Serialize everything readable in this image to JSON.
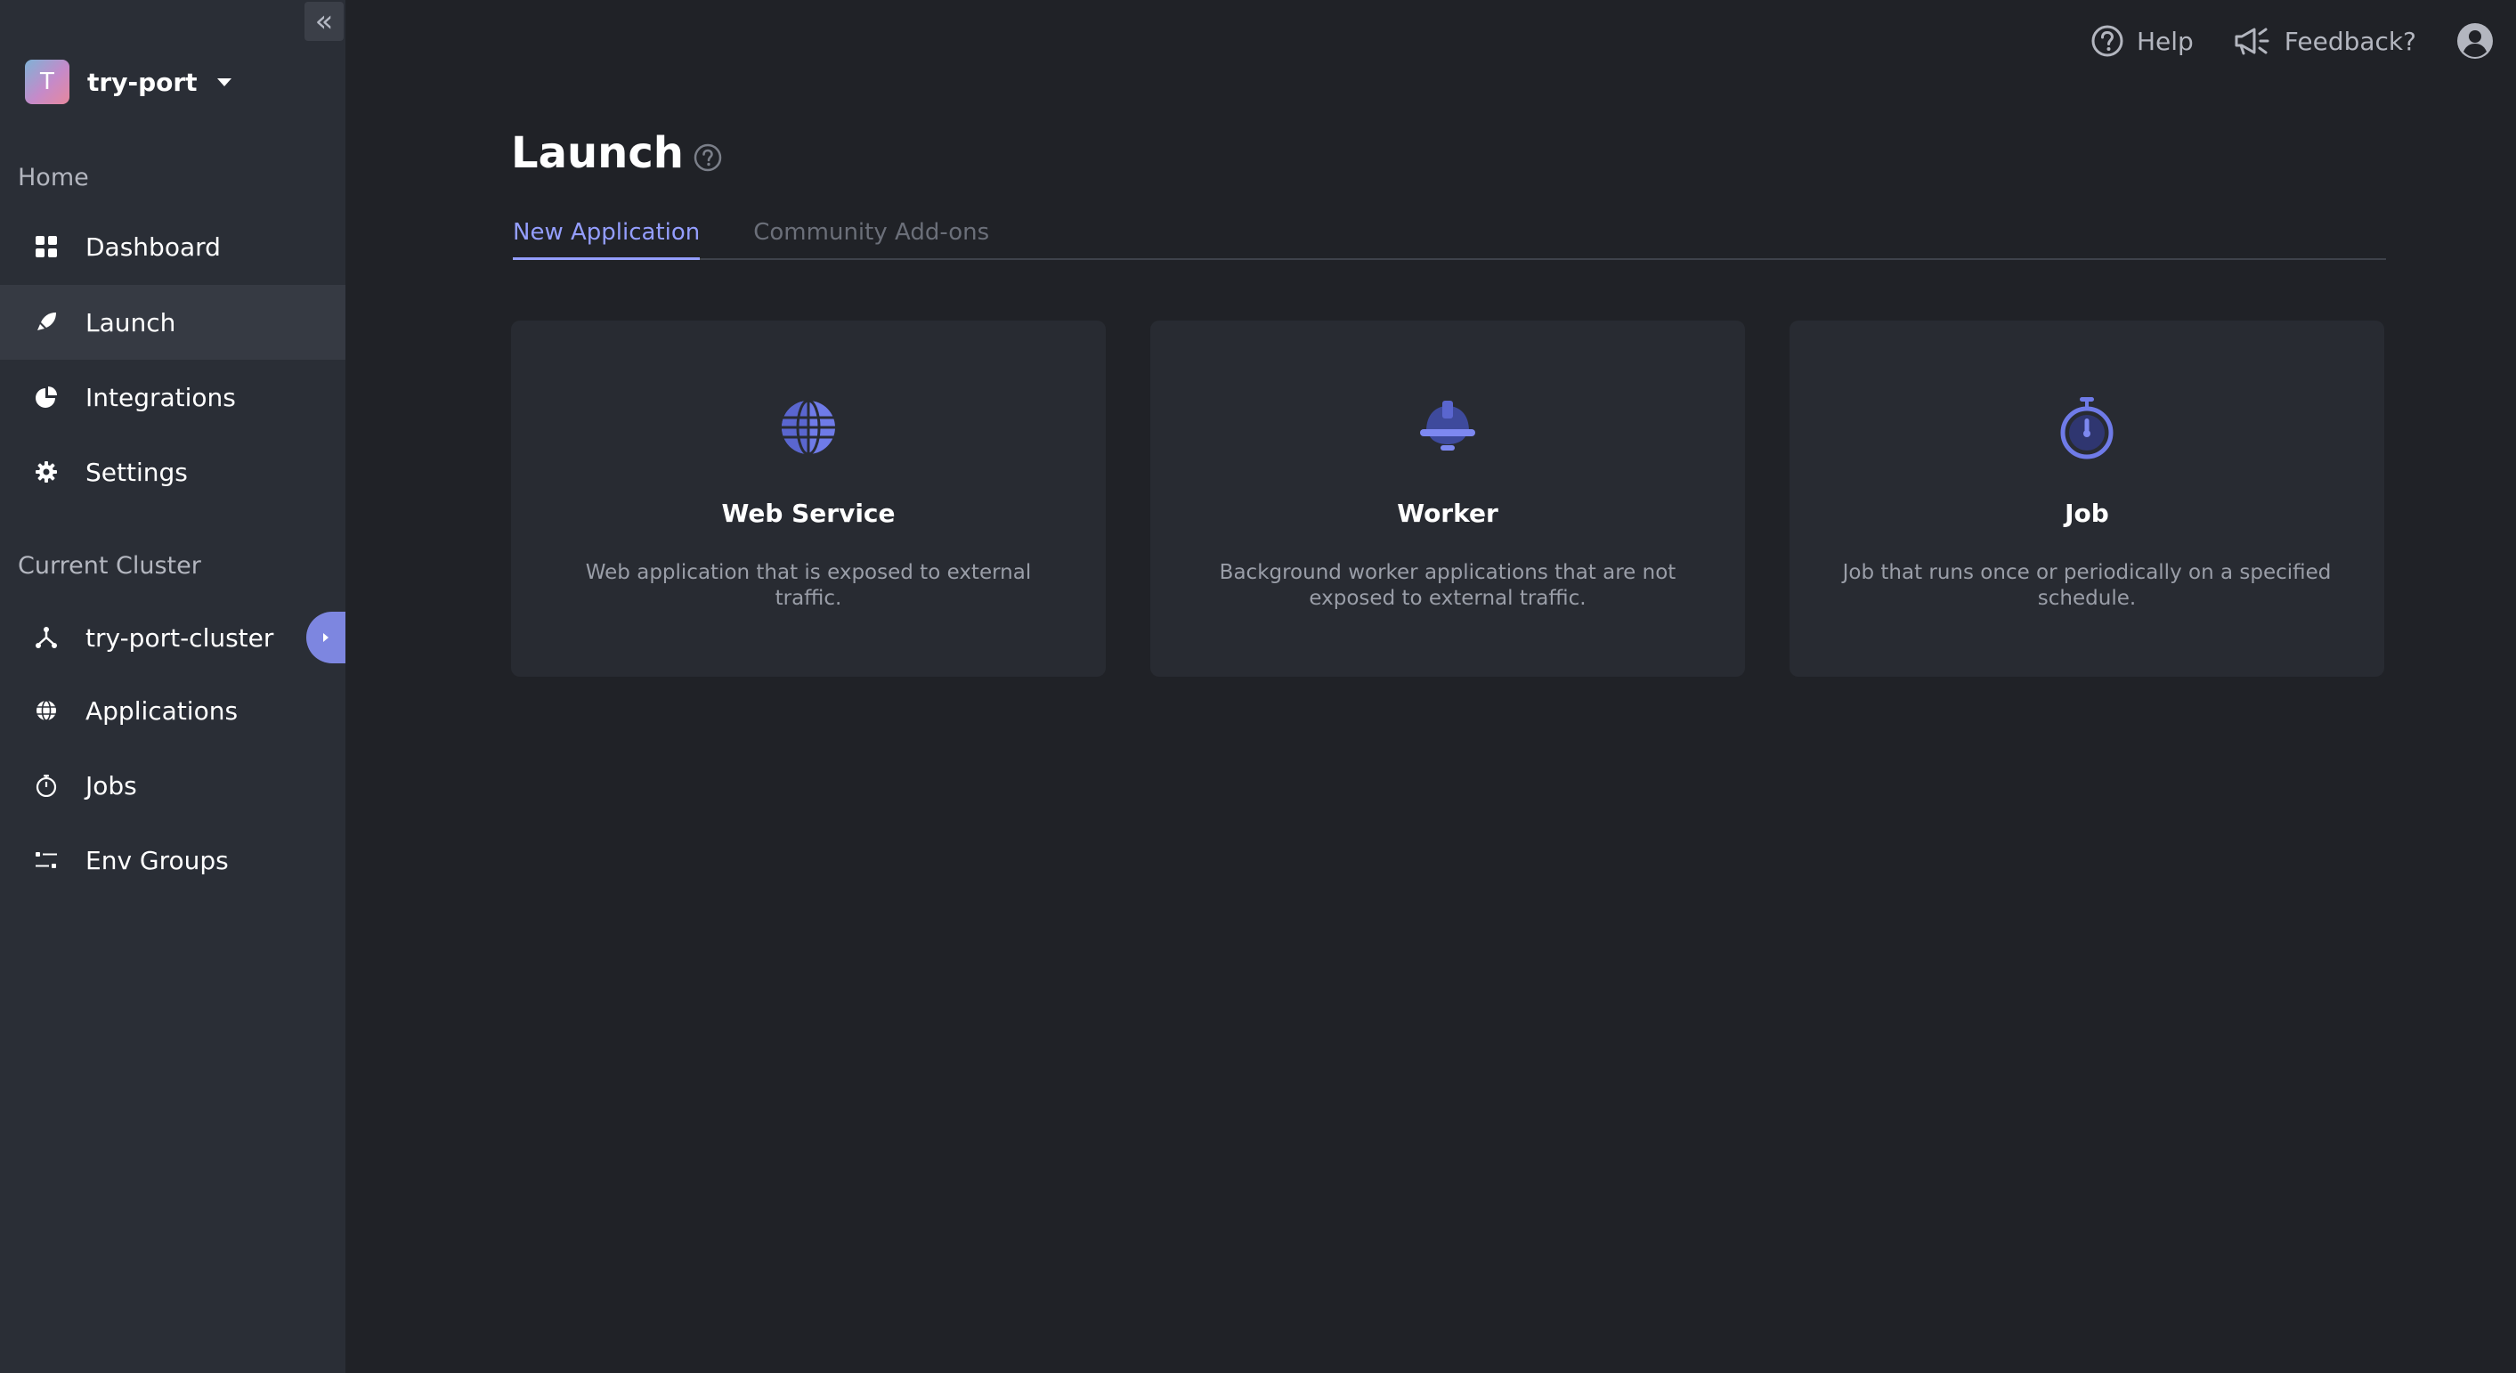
{
  "sidebar": {
    "collapse_label": "«",
    "project": {
      "initial": "T",
      "name": "try-port"
    },
    "home_section": "Home",
    "home_items": [
      {
        "label": "Dashboard",
        "icon": "dashboard-grid-icon"
      },
      {
        "label": "Launch",
        "icon": "rocket-icon",
        "active": true
      },
      {
        "label": "Integrations",
        "icon": "pie-chart-icon"
      },
      {
        "label": "Settings",
        "icon": "gear-icon"
      }
    ],
    "cluster_section": "Current Cluster",
    "cluster_items": [
      {
        "label": "try-port-cluster",
        "icon": "cluster-nodes-icon"
      },
      {
        "label": "Applications",
        "icon": "globe-icon"
      },
      {
        "label": "Jobs",
        "icon": "stopwatch-icon"
      },
      {
        "label": "Env Groups",
        "icon": "sliders-icon"
      }
    ]
  },
  "topbar": {
    "help_label": "Help",
    "feedback_label": "Feedback?"
  },
  "main": {
    "title": "Launch",
    "tabs": [
      {
        "label": "New Application",
        "active": true
      },
      {
        "label": "Community Add-ons",
        "active": false
      }
    ],
    "cards": [
      {
        "title": "Web Service",
        "description": "Web application that is exposed to external traffic.",
        "icon": "globe-icon"
      },
      {
        "title": "Worker",
        "description": "Background worker applications that are not exposed to external traffic.",
        "icon": "hard-hat-icon"
      },
      {
        "title": "Job",
        "description": "Job that runs once or periodically on a specified schedule.",
        "icon": "stopwatch-icon"
      }
    ]
  },
  "colors": {
    "accent": "#949eff",
    "sidebar_bg": "#2a2e36",
    "page_bg": "#202227",
    "card_bg": "#282b32"
  }
}
